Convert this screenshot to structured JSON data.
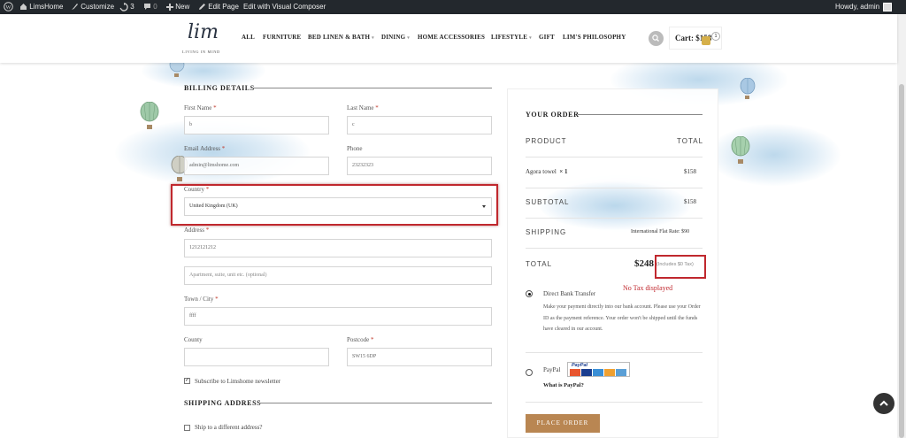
{
  "admin_bar": {
    "site_name": "LimsHome",
    "customize": "Customize",
    "updates_count": "3",
    "comments_count": "0",
    "new_label": "New",
    "edit_page": "Edit Page",
    "edit_visual": "Edit with Visual Composer",
    "greeting": "Howdy, admin"
  },
  "header": {
    "logo_text": "lim",
    "logo_tagline": "LIVING IN MIND",
    "nav": {
      "all": "ALL",
      "furniture": "FURNITURE",
      "bed_linen": "BED LINEN & BATH",
      "dining": "DINING",
      "home_accessories": "HOME ACCESSORIES",
      "lifestyle": "LIFESTYLE",
      "gift": "GIFT",
      "philosophy": "LIM'S PHILOSOPHY"
    },
    "cart_label": "Cart: $158",
    "cart_count": "1"
  },
  "billing": {
    "title": "BILLING DETAILS",
    "first_name_label": "First Name",
    "first_name_value": "b",
    "last_name_label": "Last Name",
    "last_name_value": "c",
    "email_label": "Email Address",
    "email_value": "admin@limshome.com",
    "phone_label": "Phone",
    "phone_value": "23232323",
    "country_label": "Country",
    "country_value": "United Kingdom (UK)",
    "address_label": "Address",
    "address_value": "1212121212",
    "address2_placeholder": "Apartment, suite, unit etc. (optional)",
    "city_label": "Town / City",
    "city_value": "ffff",
    "county_label": "County",
    "county_value": "",
    "postcode_label": "Postcode",
    "postcode_value": "SW15 6DP",
    "newsletter_label": "Subscribe to Limshome newsletter",
    "newsletter_checked": "✓",
    "required_mark": "*"
  },
  "shipping": {
    "title": "SHIPPING ADDRESS",
    "different_label": "Ship to a different address?"
  },
  "order": {
    "title": "YOUR ORDER",
    "product_head": "PRODUCT",
    "total_head": "TOTAL",
    "item_name": "Agora towel",
    "item_qty": "× 1",
    "item_price": "$158",
    "subtotal_label": "SUBTOTAL",
    "subtotal_value": "$158",
    "shipping_label": "SHIPPING",
    "shipping_value": "International Flat Rate: $90",
    "total_label": "TOTAL",
    "total_value": "$248",
    "tax_note": "(Includes $0 Tax)",
    "no_tax_annotation": "No Tax displayed",
    "bank_label": "Direct Bank Transfer",
    "bank_desc": "Make your payment directly into our bank account. Please use your Order ID as the payment reference. Your order won't be shipped until the funds have cleared in our account.",
    "paypal_label": "PayPal",
    "paypal_logo_text": "PayPal",
    "paypal_link": "What is PayPal?",
    "place_order": "PLACE ORDER"
  },
  "colors": {
    "admin_bar": "#23282d",
    "accent_button": "#b98652",
    "annotation_red": "#c0282e",
    "required_red": "#c0392b"
  }
}
